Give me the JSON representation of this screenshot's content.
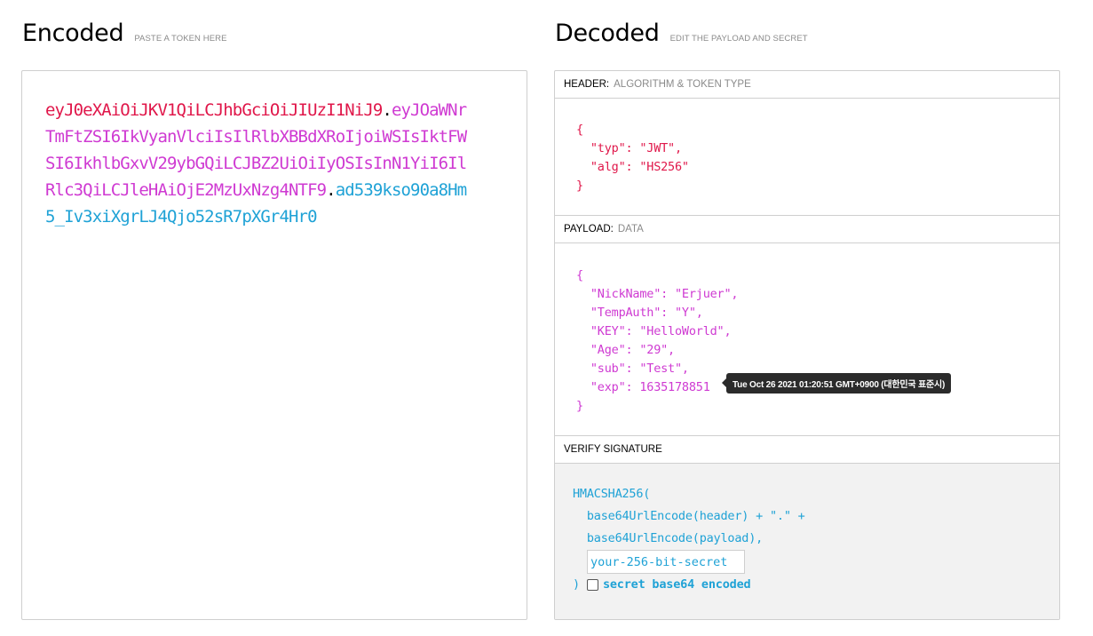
{
  "encoded": {
    "title": "Encoded",
    "subtitle": "PASTE A TOKEN HERE",
    "token_header": "eyJ0eXAiOiJKV1QiLCJhbGciOiJIUzI1NiJ9",
    "token_payload": "eyJOaWNrTmFtZSI6IkVyanVlciIsIlRlbXBBdXRoIjoiWSIsIktFWSI6IkhlbGxvV29ybGQiLCJBZ2UiOiIyOSIsInN1YiI6IlRlc3QiLCJleHAiOjE2MzUxNzg4NTF9",
    "token_signature": "ad539kso90a8Hm5_Iv3xiXgrLJ4Qjo52sR7pXGr4Hr0",
    "dot": "."
  },
  "decoded": {
    "title": "Decoded",
    "subtitle": "EDIT THE PAYLOAD AND SECRET",
    "header_section": {
      "label": "HEADER:",
      "hint": "ALGORITHM & TOKEN TYPE"
    },
    "header_json": "{\n  \"typ\": \"JWT\",\n  \"alg\": \"HS256\"\n}",
    "payload_section": {
      "label": "PAYLOAD:",
      "hint": "DATA"
    },
    "payload_json": "{\n  \"NickName\": \"Erjuer\",\n  \"TempAuth\": \"Y\",\n  \"KEY\": \"HelloWorld\",\n  \"Age\": \"29\",\n  \"sub\": \"Test\",\n  \"exp\": 1635178851\n}",
    "exp_tooltip": "Tue Oct 26 2021 01:20:51 GMT+0900 (대한민국 표준시)",
    "verify_section": {
      "label": "VERIFY SIGNATURE"
    },
    "verify_line1": "HMACSHA256(",
    "verify_line2": "  base64UrlEncode(header) + \".\" +",
    "verify_line3": "  base64UrlEncode(payload),",
    "secret_placeholder": "your-256-bit-secret",
    "closing_paren": ")",
    "base64_label": "secret base64 encoded"
  }
}
